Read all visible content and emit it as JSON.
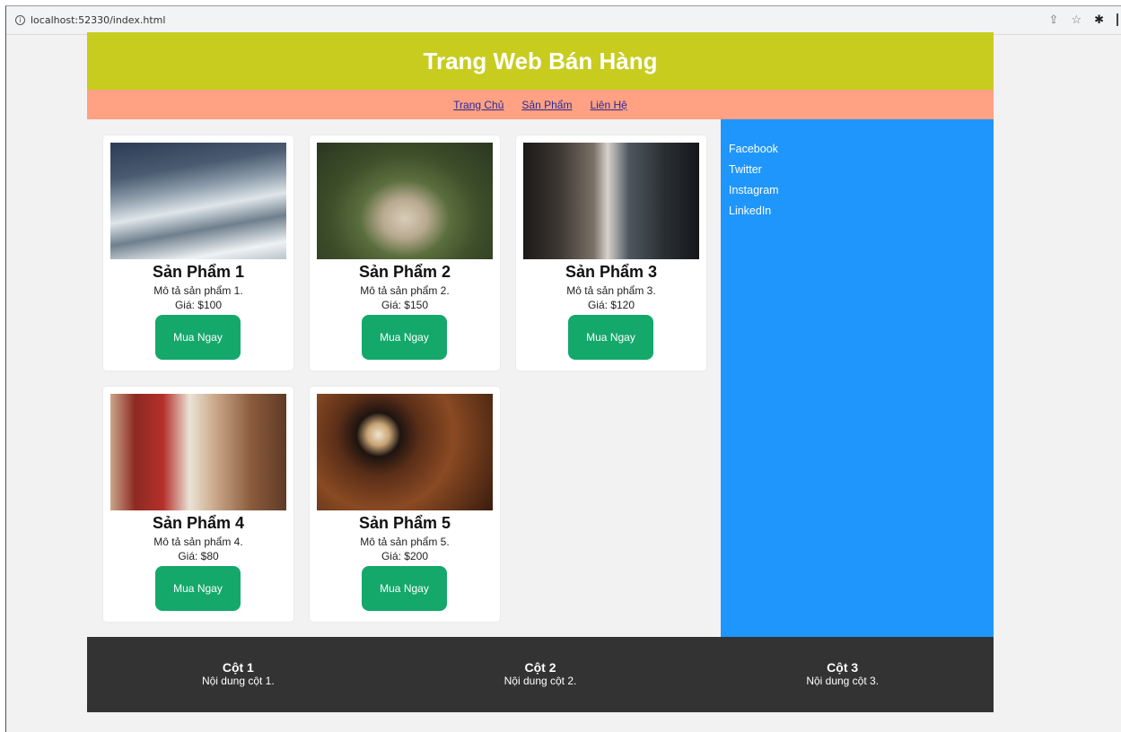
{
  "browser": {
    "url": "localhost:52330/index.html"
  },
  "header": {
    "title": "Trang Web Bán Hàng"
  },
  "nav": {
    "items": [
      "Trang Chủ",
      "Sản Phẩm",
      "Liên Hệ"
    ]
  },
  "products": [
    {
      "title": "Sản Phẩm 1",
      "desc": "Mô tả sản phẩm 1.",
      "price": "Giá: $100",
      "button": "Mua Ngay"
    },
    {
      "title": "Sản Phẩm 2",
      "desc": "Mô tả sản phẩm 2.",
      "price": "Giá: $150",
      "button": "Mua Ngay"
    },
    {
      "title": "Sản Phẩm 3",
      "desc": "Mô tả sản phẩm 3.",
      "price": "Giá: $120",
      "button": "Mua Ngay"
    },
    {
      "title": "Sản Phẩm 4",
      "desc": "Mô tả sản phẩm 4.",
      "price": "Giá: $80",
      "button": "Mua Ngay"
    },
    {
      "title": "Sản Phẩm 5",
      "desc": "Mô tả sản phẩm 5.",
      "price": "Giá: $200",
      "button": "Mua Ngay"
    }
  ],
  "sidebar": {
    "links": [
      "Facebook",
      "Twitter",
      "Instagram",
      "LinkedIn"
    ]
  },
  "footer": {
    "columns": [
      {
        "title": "Cột 1",
        "content": "Nội dung cột 1."
      },
      {
        "title": "Cột 2",
        "content": "Nội dung cột 2."
      },
      {
        "title": "Cột 3",
        "content": "Nội dung cột 3."
      }
    ]
  },
  "colors": {
    "header_bg": "#c8cc1e",
    "nav_bg": "#ffa182",
    "sidebar_bg": "#1e96fb",
    "button_bg": "#14a86b",
    "footer_bg": "#333333"
  },
  "icons": {
    "address_bar": "info-icon",
    "chrome": [
      "share-icon",
      "star-icon",
      "extension-icon"
    ]
  }
}
